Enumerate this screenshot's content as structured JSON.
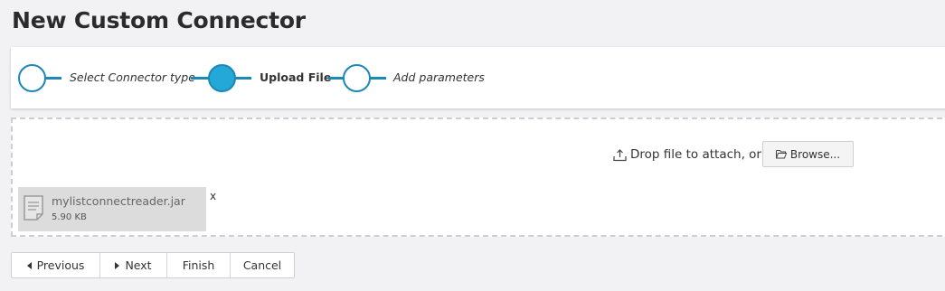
{
  "page": {
    "title": "New Custom Connector"
  },
  "wizard": {
    "steps": [
      {
        "label": "Select Connector type",
        "state": "pending"
      },
      {
        "label": "Upload File",
        "state": "active"
      },
      {
        "label": "Add parameters",
        "state": "pending"
      }
    ],
    "accent_color": "#1d87b5",
    "active_fill_color": "#24a8d8"
  },
  "upload": {
    "drop_text": "Drop file to attach, or",
    "browse_label": "Browse...",
    "upload_icon": "upload-icon",
    "browse_icon": "folder-open-icon",
    "file": {
      "name": "mylistconnectreader.jar",
      "size": "5.90 KB",
      "icon": "file-icon"
    },
    "remove_label": "x"
  },
  "buttons": {
    "previous": "Previous",
    "next": "Next",
    "finish": "Finish",
    "cancel": "Cancel"
  }
}
